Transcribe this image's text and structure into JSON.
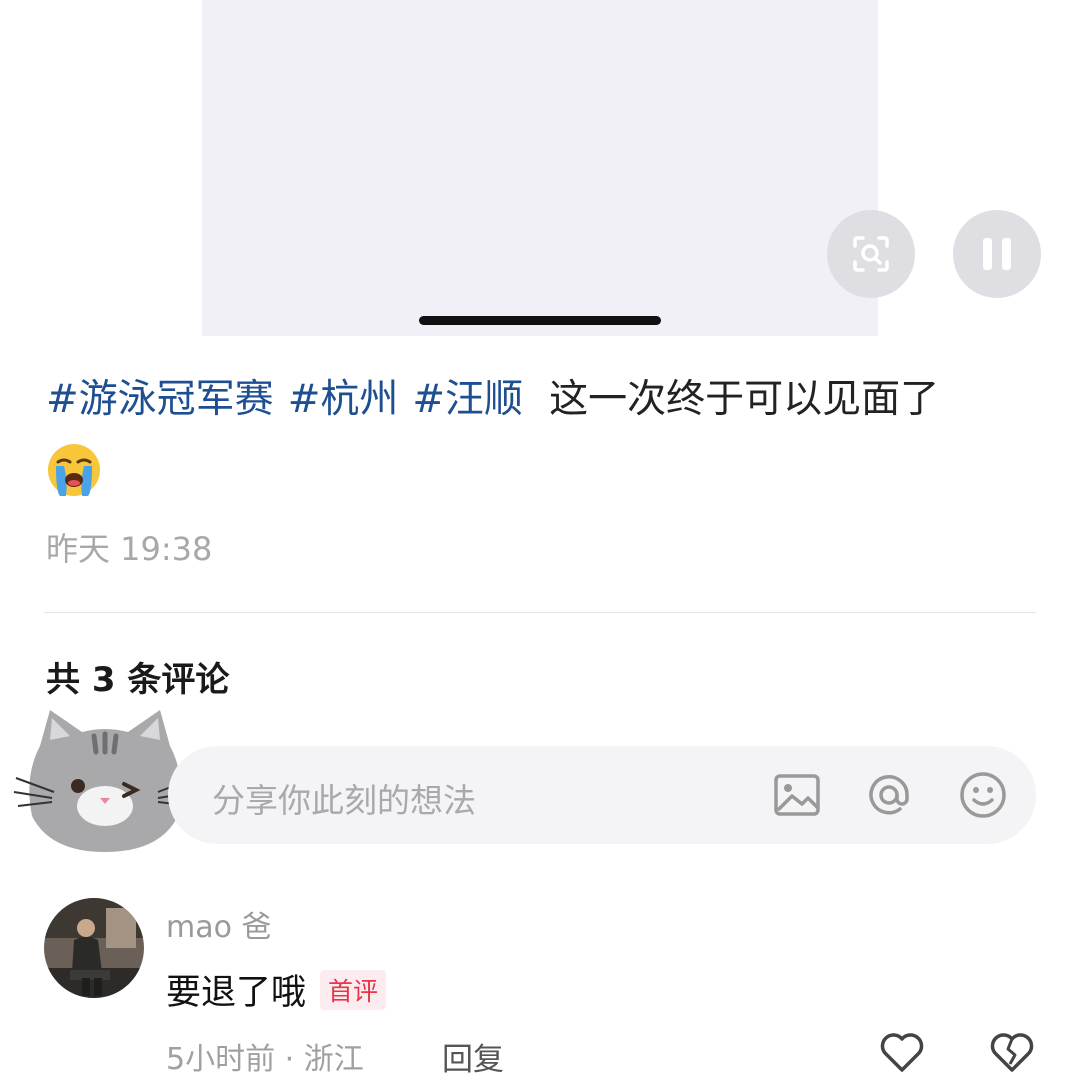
{
  "post": {
    "tags": [
      "#游泳冠军赛",
      "#杭州",
      "#汪顺"
    ],
    "caption": "这一次终于可以见面了",
    "emoji": "😭",
    "timestamp": "昨天 19:38"
  },
  "comments_section": {
    "count_label": "共 3 条评论",
    "input_placeholder": "分享你此刻的想法"
  },
  "comments": [
    {
      "username": "mao 爸",
      "text": "要退了哦",
      "badge": "首评",
      "meta": "5小时前 · 浙江",
      "reply_label": "回复"
    }
  ],
  "icons": {
    "media_scan": "scan-search-icon",
    "media_pause": "pause-icon",
    "input_image": "image-icon",
    "input_at": "at-icon",
    "input_emoji": "smile-icon",
    "like": "heart-icon",
    "dislike": "broken-heart-icon"
  },
  "colors": {
    "hashtag": "#1d4f91",
    "badge": "#e8334a",
    "muted": "#a8a8a8"
  }
}
